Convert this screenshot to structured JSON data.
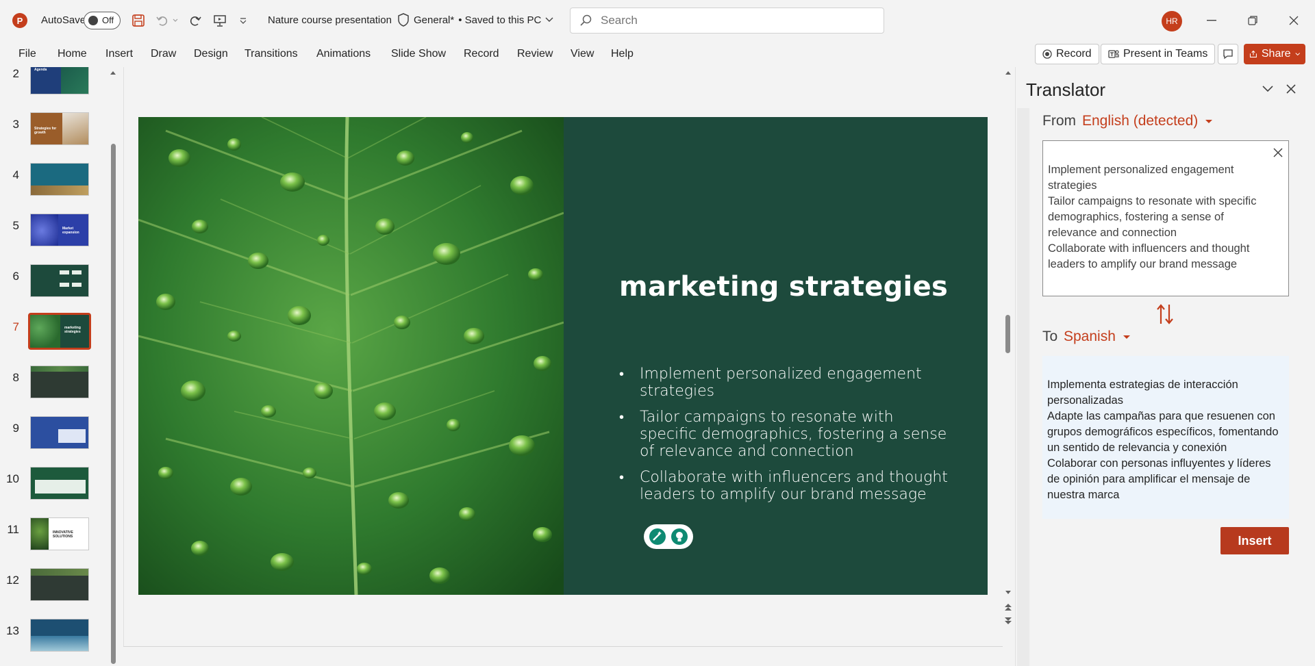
{
  "app": {
    "logo_letter": "P",
    "autosave_label": "AutoSave",
    "autosave_state": "Off",
    "doc_title": "Nature course presentation",
    "sensitivity": "General*",
    "save_status": "•  Saved to this PC",
    "search_placeholder": "Search",
    "user_initials": "HR"
  },
  "ribbon": {
    "tabs": [
      "File",
      "Home",
      "Insert",
      "Draw",
      "Design",
      "Transitions",
      "Animations",
      "Slide Show",
      "Record",
      "Review",
      "View",
      "Help"
    ],
    "record_label": "Record",
    "present_label": "Present in Teams",
    "share_label": "Share"
  },
  "thumbnails": [
    {
      "num": "2",
      "bg": "#1f3e7a",
      "title": "Agenda"
    },
    {
      "num": "3",
      "bg": "#9a5d2a",
      "title": "Strategies for growth"
    },
    {
      "num": "4",
      "bg": "#1b6a80",
      "title": ""
    },
    {
      "num": "5",
      "bg": "#2c3fa8",
      "title": "Market expansion"
    },
    {
      "num": "6",
      "bg": "#1d4a3c",
      "title": ""
    },
    {
      "num": "7",
      "bg": "#2e6b3a",
      "title": "marketing strategies",
      "selected": true
    },
    {
      "num": "8",
      "bg": "#2e3a33",
      "title": ""
    },
    {
      "num": "9",
      "bg": "#2c4fa0",
      "title": ""
    },
    {
      "num": "10",
      "bg": "#1d5a3c",
      "title": ""
    },
    {
      "num": "11",
      "bg": "#ffffff",
      "title": "INNOVATIVE SOLUTIONS"
    },
    {
      "num": "12",
      "bg": "#2f3a34",
      "title": ""
    },
    {
      "num": "13",
      "bg": "#1d4f72",
      "title": ""
    }
  ],
  "slide": {
    "title": "marketing strategies",
    "bullets": [
      "Implement personalized engagement strategies",
      "Tailor campaigns to resonate with specific demographics, fostering a sense of relevance and connection",
      "Collaborate with influencers and thought leaders to amplify our brand message"
    ]
  },
  "translator": {
    "title": "Translator",
    "from_label": "From",
    "from_lang": "English (detected)",
    "source_text": "Implement personalized engagement strategies\nTailor campaigns to resonate with specific demographics, fostering a sense of relevance and connection\nCollaborate with influencers and thought leaders to amplify our brand message",
    "to_label": "To",
    "to_lang": "Spanish",
    "target_text": "Implementa estrategias de interacción personalizadas\nAdapte las campañas para que resuenen con grupos demográficos específicos, fomentando un sentido de relevancia y conexión\nColaborar con personas influyentes y líderes de opinión para amplificar el mensaje de nuestra marca",
    "insert_label": "Insert"
  },
  "colors": {
    "accent": "#c43e1c",
    "slide_bg": "#1d4a3c",
    "target_bg": "#edf4fb"
  }
}
